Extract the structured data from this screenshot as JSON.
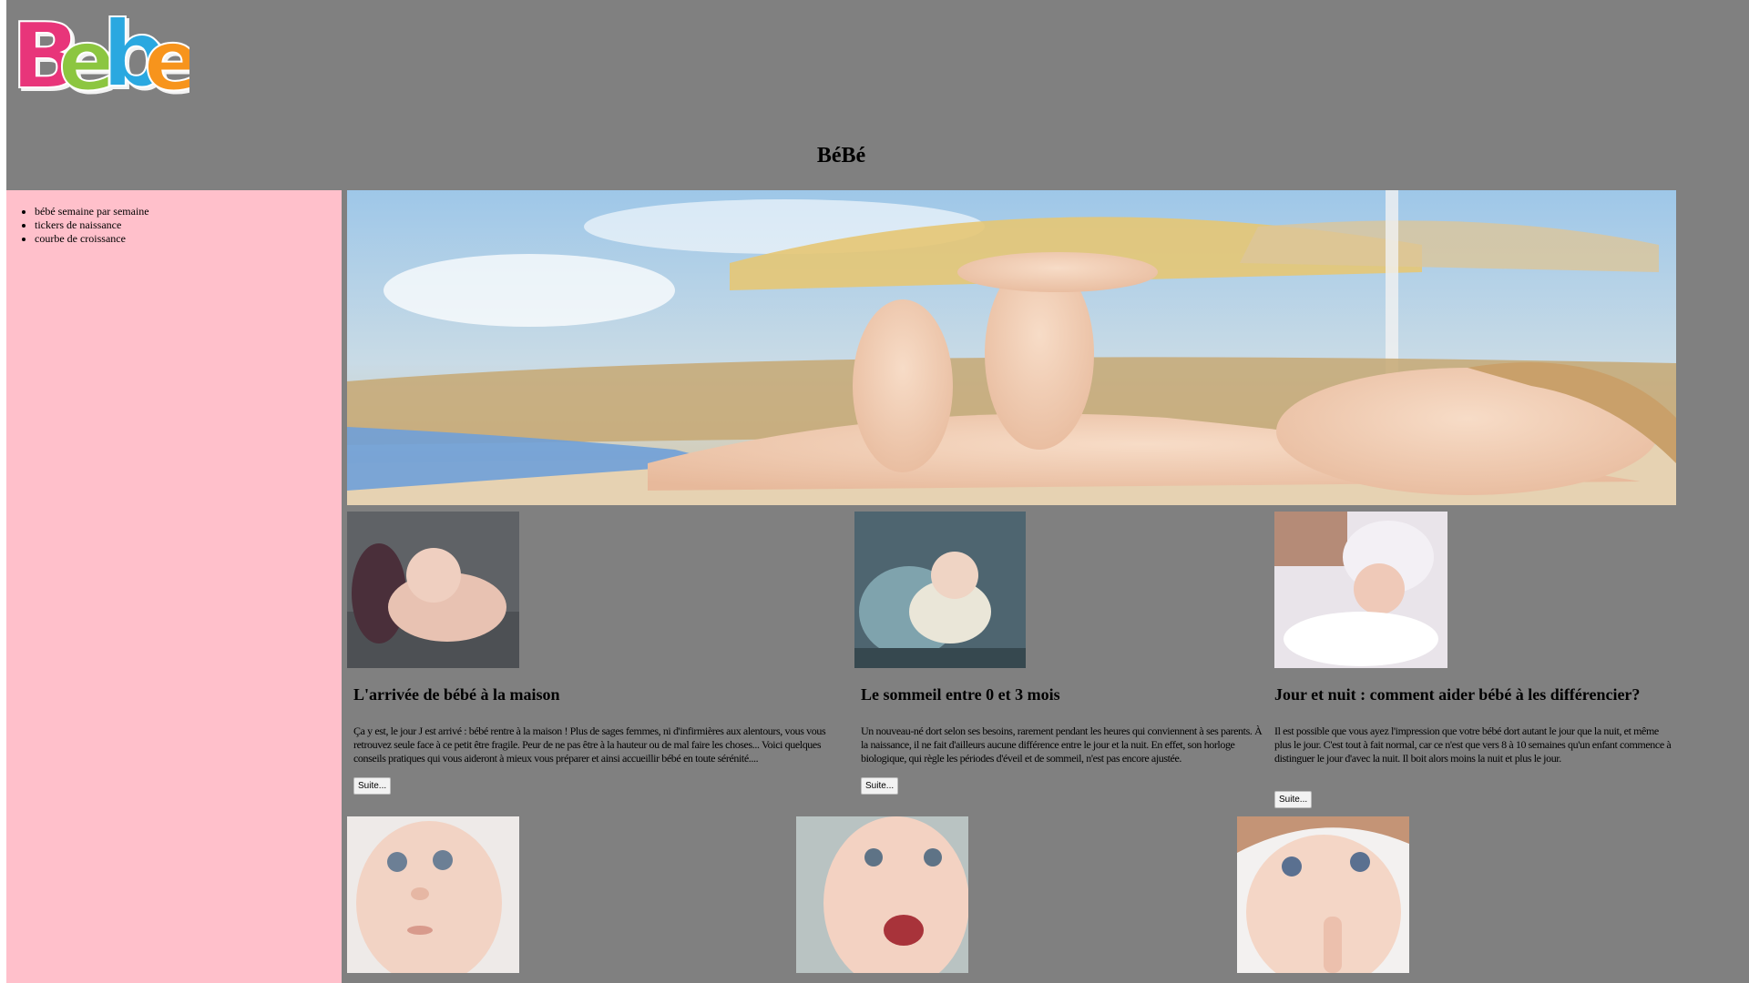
{
  "header": {
    "logo_text": "Bebe",
    "logo_letters": [
      "B",
      "e",
      "b",
      "e"
    ],
    "logo_colors": [
      "#e8347a",
      "#8cc63f",
      "#29a8e0",
      "#f7941d"
    ],
    "title": "BéBé"
  },
  "sidebar": {
    "background": "#ffc0cb",
    "items": [
      {
        "label": "bébé semaine par semaine"
      },
      {
        "label": "tickers de naissance"
      },
      {
        "label": "courbe de croissance"
      }
    ]
  },
  "hero": {
    "image": "baby-lying-on-beach-towel-photo"
  },
  "articles": [
    {
      "title": "L'arrivée de bébé à la maison",
      "text": "Ça y est, le jour J est arrivé : bébé rentre à la maison ! Plus de sages femmes, ni d'infirmières aux alentours, vous vous retrouvez seule face à ce petit être fragile. Peur de ne pas être à la hauteur ou de mal faire les choses... Voici quelques conseils pratiques qui vous aideront à mieux vous préparer et ainsi accueillir bébé en toute sérénité....",
      "button": "Suite...",
      "image": "sleeping-newborn-photo"
    },
    {
      "title": "Le sommeil entre 0 et 3 mois",
      "text": "Un nouveau-né dort selon ses besoins, rarement pendant les heures qui conviennent à ses parents. À la naissance, il ne fait d'ailleurs aucune différence entre le jour et la nuit. En effet, son horloge biologique, qui règle les périodes d'éveil et de sommeil, n'est pas encore ajustée.",
      "button": "Suite...",
      "image": "sleeping-baby-blanket-photo"
    },
    {
      "title": "Jour et nuit : comment aider bébé à les différencier?",
      "text": "Il est possible que vous ayez l'impression que votre bébé dort autant le jour que la nuit, et même plus le jour. C'est tout à fait normal, car ce n'est que vers 8 à 10 semaines qu'un enfant commence à distinguer le jour d'avec la nuit. Il boit alors moins la nuit et plus le jour.",
      "button": "Suite...",
      "image": "newborn-white-hat-photo"
    }
  ],
  "gallery": [
    {
      "image": "baby-face-photo-1"
    },
    {
      "image": "baby-face-photo-2"
    },
    {
      "image": "baby-face-photo-3"
    }
  ]
}
